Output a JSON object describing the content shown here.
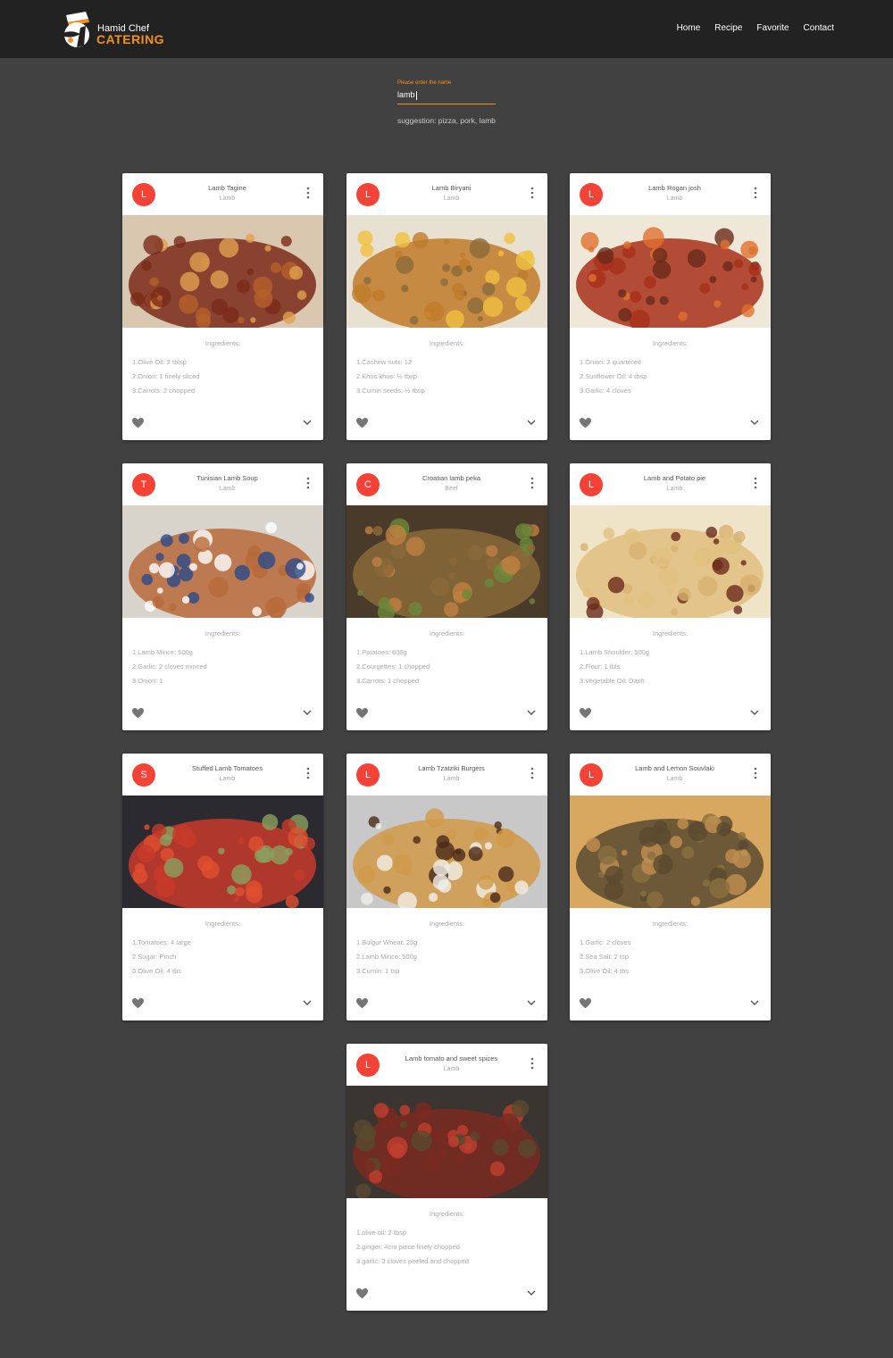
{
  "header": {
    "logo_line1": "Hamid Chef",
    "logo_line2": "CATERING",
    "nav": [
      "Home",
      "Recipe",
      "Favorite",
      "Contact"
    ]
  },
  "search": {
    "label": "Please enter the name",
    "value": "lamb",
    "suggestion": "suggestion: pizza, pork, lamb"
  },
  "ingredients_heading": "Ingredients:",
  "colors": {
    "accent": "#f5911e",
    "avatar": "#f44336",
    "background": "#414141",
    "header": "#222222"
  },
  "cards": [
    {
      "avatar": "L",
      "title": "Lamb Tagine",
      "category": "Lamb",
      "ingredients": [
        "1.Olive Oil: 2 tblsp",
        "2.Onion: 1 finely sliced",
        "3.Carrots: 2 chopped"
      ]
    },
    {
      "avatar": "L",
      "title": "Lamb Biryani",
      "category": "Lamb",
      "ingredients": [
        "1.Cashew nuts: 12",
        "2.Khus khus: ½ tbsp",
        "3.Cumin seeds: ½ tbsp"
      ]
    },
    {
      "avatar": "L",
      "title": "Lamb Rogan josh",
      "category": "Lamb",
      "ingredients": [
        "1.Onion: 2 quartered",
        "2.Sunflower Oil: 4 tbsp",
        "3.Garlic: 4 cloves"
      ]
    },
    {
      "avatar": "T",
      "title": "Tunisian Lamb Soup",
      "category": "Lamb",
      "ingredients": [
        "1.Lamb Mince: 500g",
        "2.Garlic: 2 cloves minced",
        "3.Onion: 1"
      ]
    },
    {
      "avatar": "C",
      "title": "Croatian lamb peka",
      "category": "Beef",
      "ingredients": [
        "1.Potatoes: 600g",
        "2.Courgettes: 1 chopped",
        "3.Carrots: 1 chopped"
      ]
    },
    {
      "avatar": "L",
      "title": "Lamb and Potato pie",
      "category": "Lamb",
      "ingredients": [
        "1.Lamb Shoulder: 500g",
        "2.Flour: 1 tbls",
        "3.Vegetable Oil: Dash"
      ]
    },
    {
      "avatar": "S",
      "title": "Stuffed Lamb Tomatoes",
      "category": "Lamb",
      "ingredients": [
        "1.Tomatoes: 4 large",
        "2.Sugar: Pinch",
        "3.Olive Oil: 4 tbs"
      ]
    },
    {
      "avatar": "L",
      "title": "Lamb Tzatziki Burgers",
      "category": "Lamb",
      "ingredients": [
        "1.Bulgur Wheat: 25g",
        "2.Lamb Mince: 500g",
        "3.Cumin: 1 tsp"
      ]
    },
    {
      "avatar": "L",
      "title": "Lamb and Lemon Souvlaki",
      "category": "Lamb",
      "ingredients": [
        "1.Garlic: 2 cloves",
        "2.Sea Salt: 2 tsp",
        "3.Olive Oil: 4 tbs"
      ]
    },
    {
      "avatar": "L",
      "title": "Lamb tomato and sweet spices",
      "category": "Lamb",
      "ingredients": [
        "1.olive oil: 2 tbsp",
        "2.ginger: 4cm piece finely chopped",
        "3.garlic: 2 cloves peeled and chopped"
      ]
    }
  ]
}
